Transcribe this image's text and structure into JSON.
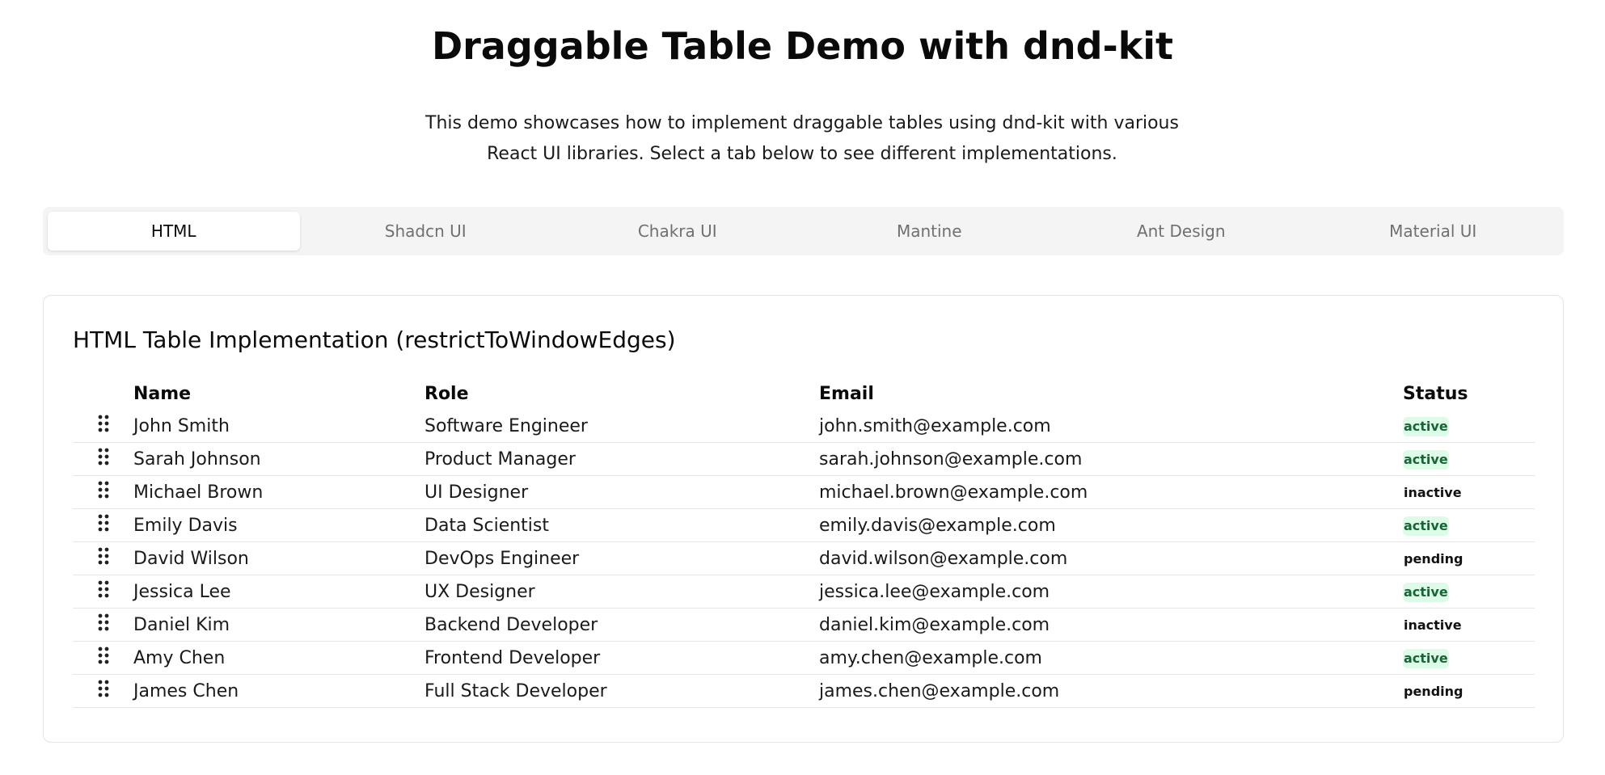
{
  "header": {
    "title": "Draggable Table Demo with dnd-kit",
    "description": "This demo showcases how to implement draggable tables using dnd-kit with various React UI libraries. Select a tab below to see different implementations."
  },
  "tabs": [
    {
      "label": "HTML",
      "active": true
    },
    {
      "label": "Shadcn UI",
      "active": false
    },
    {
      "label": "Chakra UI",
      "active": false
    },
    {
      "label": "Mantine",
      "active": false
    },
    {
      "label": "Ant Design",
      "active": false
    },
    {
      "label": "Material UI",
      "active": false
    }
  ],
  "card": {
    "title": "HTML Table Implementation (restrictToWindowEdges)"
  },
  "table": {
    "columns": [
      "",
      "Name",
      "Role",
      "Email",
      "Status"
    ],
    "drag_icon": "grip-vertical-icon",
    "rows": [
      {
        "name": "John Smith",
        "role": "Software Engineer",
        "email": "john.smith@example.com",
        "status": "active"
      },
      {
        "name": "Sarah Johnson",
        "role": "Product Manager",
        "email": "sarah.johnson@example.com",
        "status": "active"
      },
      {
        "name": "Michael Brown",
        "role": "UI Designer",
        "email": "michael.brown@example.com",
        "status": "inactive"
      },
      {
        "name": "Emily Davis",
        "role": "Data Scientist",
        "email": "emily.davis@example.com",
        "status": "active"
      },
      {
        "name": "David Wilson",
        "role": "DevOps Engineer",
        "email": "david.wilson@example.com",
        "status": "pending"
      },
      {
        "name": "Jessica Lee",
        "role": "UX Designer",
        "email": "jessica.lee@example.com",
        "status": "active"
      },
      {
        "name": "Daniel Kim",
        "role": "Backend Developer",
        "email": "daniel.kim@example.com",
        "status": "inactive"
      },
      {
        "name": "Amy Chen",
        "role": "Frontend Developer",
        "email": "amy.chen@example.com",
        "status": "active"
      },
      {
        "name": "James Chen",
        "role": "Full Stack Developer",
        "email": "james.chen@example.com",
        "status": "pending"
      }
    ]
  },
  "colors": {
    "active_badge_bg": "#dcfce7",
    "active_badge_text": "#166534",
    "tab_bar_bg": "#f4f4f4"
  }
}
